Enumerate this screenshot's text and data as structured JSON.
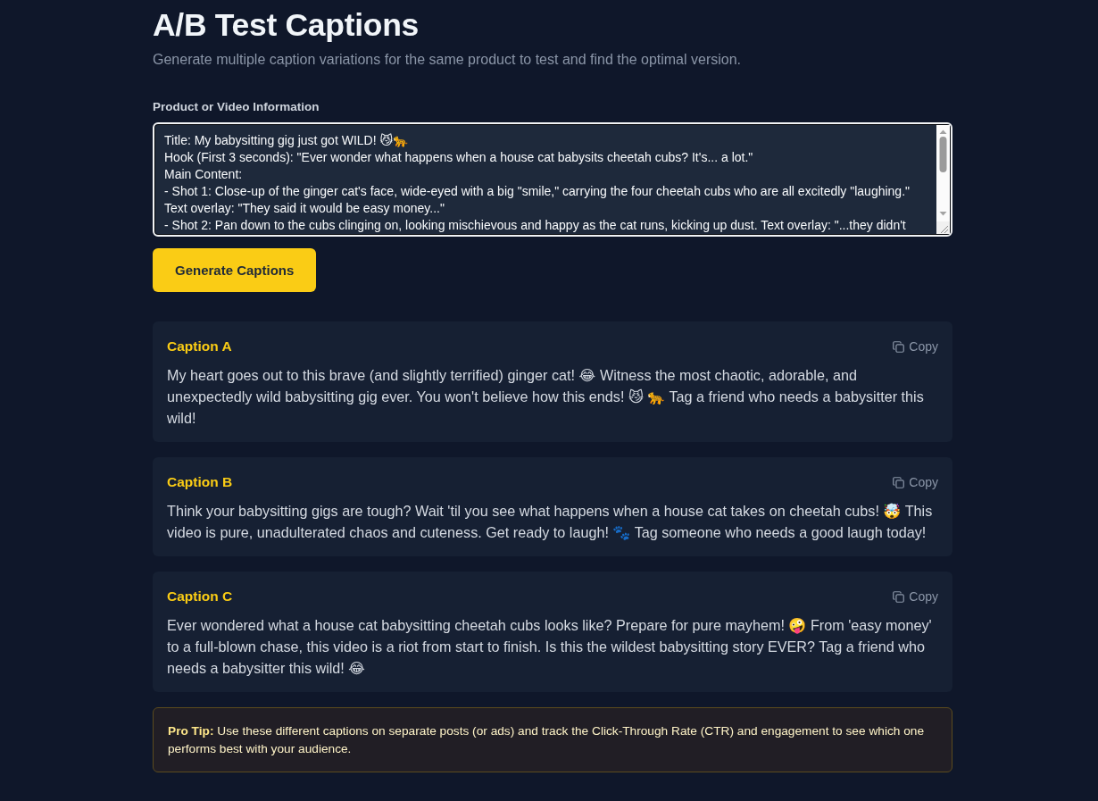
{
  "page": {
    "title": "A/B Test Captions",
    "subtitle": "Generate multiple caption variations for the same product to test and find the optimal version."
  },
  "product_field": {
    "label": "Product or Video Information",
    "value": "Title: My babysitting gig just got WILD! 😼🐆\nHook (First 3 seconds): \"Ever wonder what happens when a house cat babysits cheetah cubs? It's... a lot.\"\nMain Content:\n- Shot 1: Close-up of the ginger cat's face, wide-eyed with a big \"smile,\" carrying the four cheetah cubs who are all excitedly \"laughing.\"\nText overlay: \"They said it would be easy money...\"\n- Shot 2: Pan down to the cubs clinging on, looking mischievous and happy as the cat runs, kicking up dust. Text overlay: \"...they didn't"
  },
  "generate_button": "Generate Captions",
  "captions": [
    {
      "title": "Caption A",
      "copy_label": "Copy",
      "text": "My heart goes out to this brave (and slightly terrified) ginger cat! 😂 Witness the most chaotic, adorable, and unexpectedly wild babysitting gig ever. You won't believe how this ends! 😼 🐆 Tag a friend who needs a babysitter this wild!"
    },
    {
      "title": "Caption B",
      "copy_label": "Copy",
      "text": "Think your babysitting gigs are tough? Wait 'til you see what happens when a house cat takes on cheetah cubs! 🤯 This video is pure, unadulterated chaos and cuteness. Get ready to laugh! 🐾 Tag someone who needs a good laugh today!"
    },
    {
      "title": "Caption C",
      "copy_label": "Copy",
      "text": "Ever wondered what a house cat babysitting cheetah cubs looks like? Prepare for pure mayhem! 🤪 From 'easy money' to a full-blown chase, this video is a riot from start to finish. Is this the wildest babysitting story EVER? Tag a friend who needs a babysitter this wild! 😂"
    }
  ],
  "pro_tip": "**Pro Tip:** Use these different captions on separate posts (or ads) and track the Click-Through Rate (CTR) and engagement to see which one performs best with your audience."
}
